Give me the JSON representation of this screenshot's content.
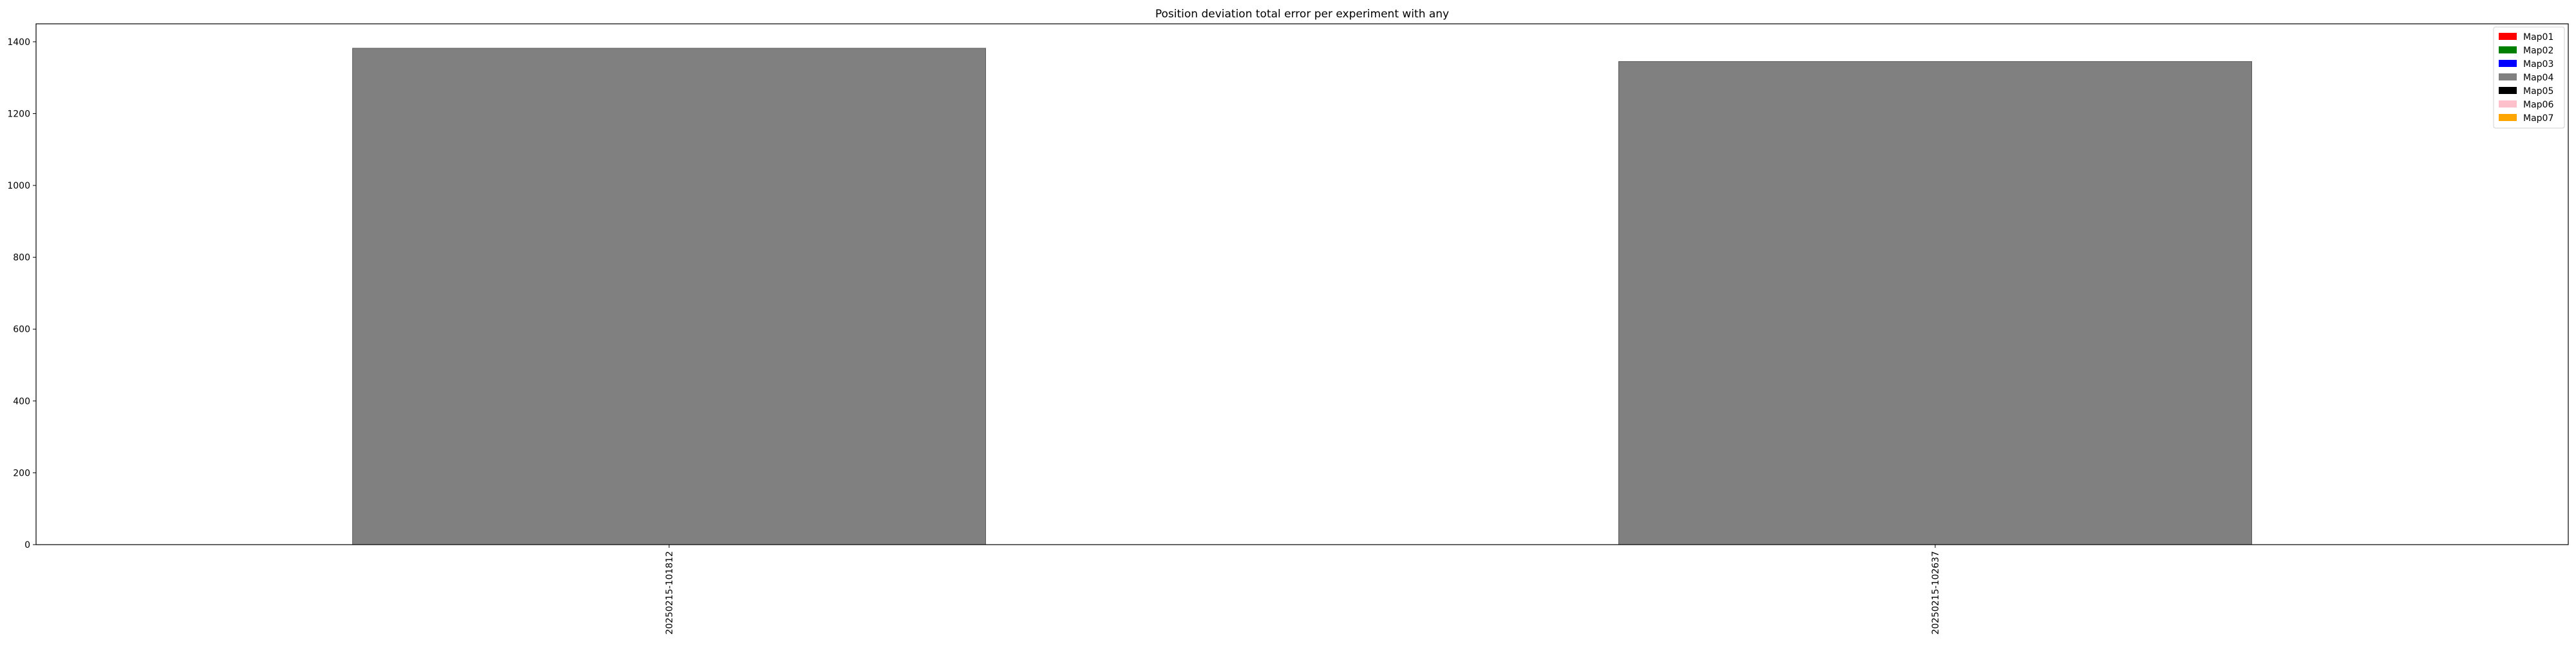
{
  "chart_data": {
    "type": "bar",
    "title": "Position deviation total error per experiment with any",
    "xlabel": "",
    "ylabel": "",
    "categories": [
      "20250215-101812",
      "20250215-102637"
    ],
    "ylim": [
      0,
      1450
    ],
    "yticks": [
      0,
      200,
      400,
      600,
      800,
      1000,
      1200,
      1400
    ],
    "series": [
      {
        "name": "Map04",
        "color": "#808080",
        "values": [
          1382,
          1345
        ]
      }
    ],
    "legend": {
      "placement": "top-right",
      "entries": [
        {
          "label": "Map01",
          "color": "#ff0000"
        },
        {
          "label": "Map02",
          "color": "#008000"
        },
        {
          "label": "Map03",
          "color": "#0000ff"
        },
        {
          "label": "Map04",
          "color": "#808080"
        },
        {
          "label": "Map05",
          "color": "#000000"
        },
        {
          "label": "Map06",
          "color": "#ffc0cb"
        },
        {
          "label": "Map07",
          "color": "#ffa500"
        }
      ]
    },
    "grid": false
  }
}
